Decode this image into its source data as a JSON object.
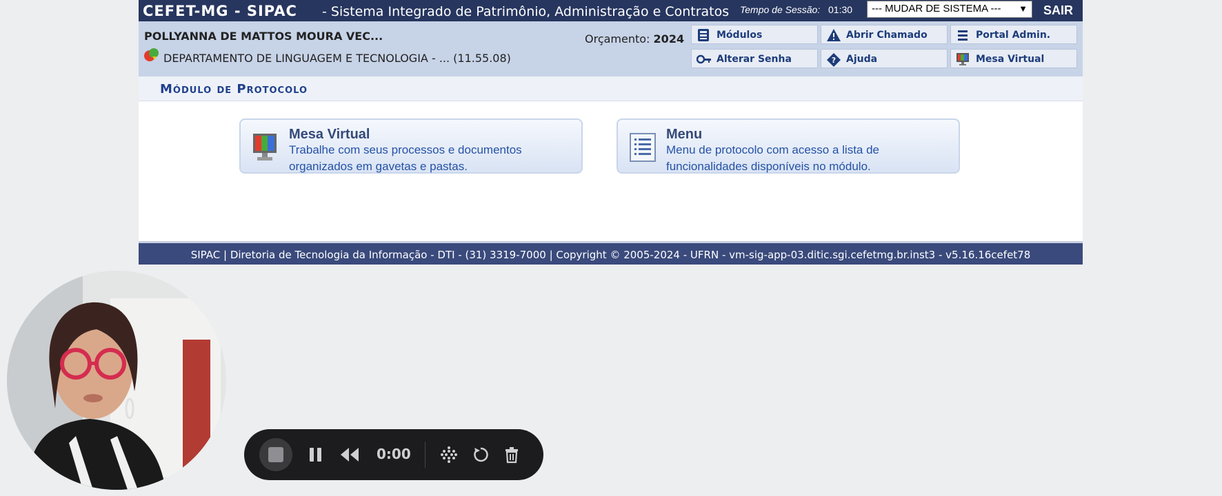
{
  "header": {
    "brand": "CEFET-MG - SIPAC",
    "subtitle": "- Sistema Integrado de Patrimônio, Administração e Contratos",
    "session_label": "Tempo de Sessão:",
    "session_time": "01:30",
    "system_select": "--- MUDAR DE SISTEMA ---",
    "logout": "SAIR"
  },
  "user": {
    "name": "POLLYANNA DE MATTOS MOURA VEC...",
    "department": "DEPARTAMENTO DE LINGUAGEM E TECNOLOGIA - ... (11.55.08)",
    "budget_label": "Orçamento:",
    "budget_year": "2024"
  },
  "quick_links": [
    {
      "label": "Módulos",
      "icon": "modules-icon"
    },
    {
      "label": "Abrir Chamado",
      "icon": "warning-icon"
    },
    {
      "label": "Portal Admin.",
      "icon": "list-icon"
    },
    {
      "label": "Alterar Senha",
      "icon": "key-icon"
    },
    {
      "label": "Ajuda",
      "icon": "help-icon"
    },
    {
      "label": "Mesa Virtual",
      "icon": "monitor-icon"
    }
  ],
  "module": {
    "title": "Módulo de Protocolo"
  },
  "cards": [
    {
      "title": "Mesa Virtual",
      "description": "Trabalhe com seus processos e documentos organizados em gavetas e pastas.",
      "icon": "monitor-icon"
    },
    {
      "title": "Menu",
      "description": "Menu de protocolo com acesso a lista de funcionalidades disponíveis no módulo.",
      "icon": "document-list-icon"
    }
  ],
  "footer": {
    "text": "SIPAC | Diretoria de Tecnologia da Informação - DTI - (31) 3319-7000 | Copyright © 2005-2024 - UFRN - vm-sig-app-03.ditic.sgi.cefetmg.br.inst3 - v5.16.16cefet78"
  },
  "recorder": {
    "time": "0:00",
    "controls": [
      "stop-icon",
      "pause-icon",
      "rewind-icon",
      "grid-icon",
      "restart-icon",
      "trash-icon"
    ]
  }
}
